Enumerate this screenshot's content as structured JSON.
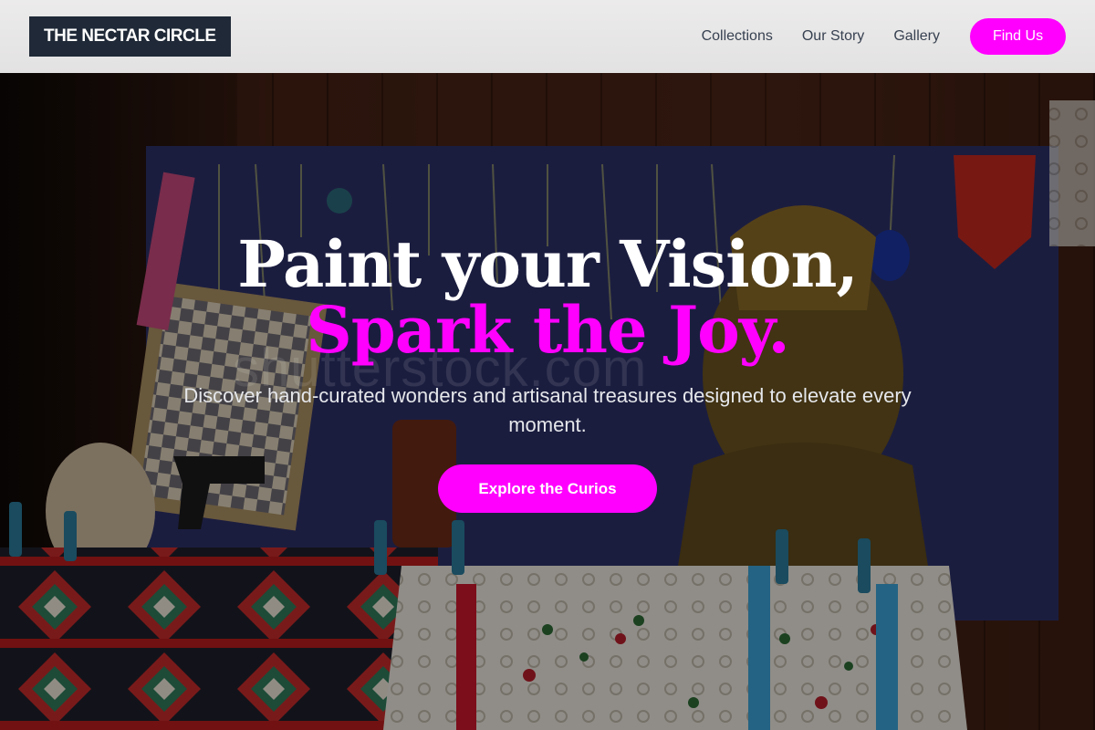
{
  "brand": {
    "name": "THE NECTAR CIRCLE"
  },
  "nav": {
    "links": [
      "Collections",
      "Our Story",
      "Gallery"
    ],
    "cta_label": "Find Us"
  },
  "hero": {
    "title_line1": "Paint your Vision,",
    "title_line2": "Spark the Joy.",
    "subtitle": "Discover hand-curated wonders and artisanal treasures designed to elevate every moment.",
    "cta_label": "Explore the Curios",
    "watermark": "shutterstock.com"
  },
  "colors": {
    "accent": "#ff00ff",
    "logo_bg": "#1f2937",
    "header_bg": "#ebeaea",
    "nav_text": "#374151"
  }
}
